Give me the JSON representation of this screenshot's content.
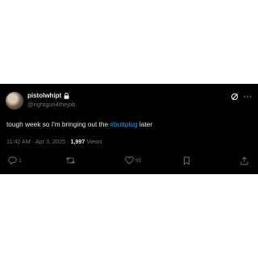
{
  "post": {
    "display_name": "pistolwhipt",
    "handle": "@rightgun4thejob",
    "text_prefix": "tough week so I'm bringing out the ",
    "hashtag": "#buttplug",
    "text_suffix": " later",
    "time": "11:42 AM",
    "date": "Apr 3, 2025",
    "separator": "·",
    "views_count": "1,997",
    "views_label": "Views"
  },
  "actions": {
    "reply_count": "1",
    "like_count": "95"
  },
  "icons": {
    "lock": "lock-icon",
    "grok": "grok-icon",
    "more": "more-icon",
    "reply": "reply-icon",
    "repost": "repost-icon",
    "like": "heart-icon",
    "bookmark": "bookmark-icon",
    "share": "share-icon"
  },
  "colors": {
    "background": "#000000",
    "text": "#e7e9ea",
    "secondary": "#71767b",
    "link": "#1d9bf0"
  }
}
